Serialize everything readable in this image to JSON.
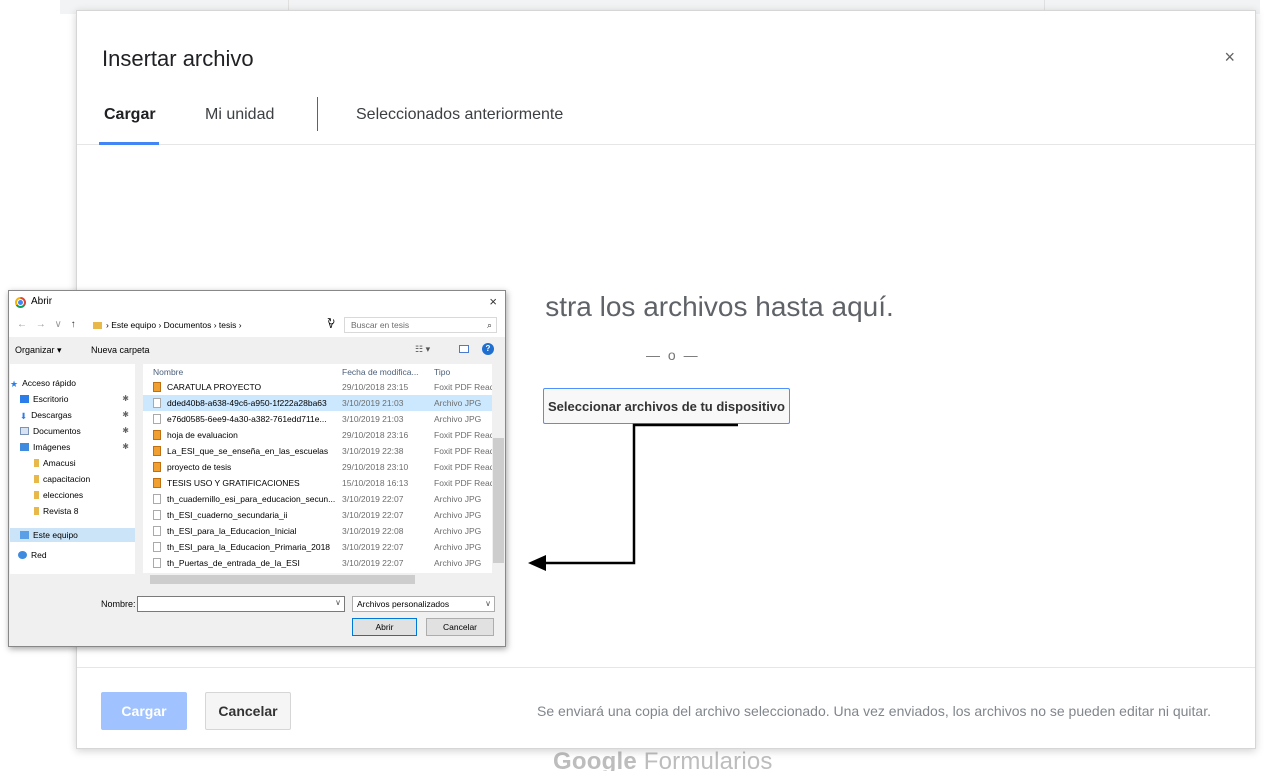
{
  "dialog": {
    "title": "Insertar archivo",
    "close_icon": "×",
    "tabs": [
      "Cargar",
      "Mi unidad",
      "Seleccionados anteriormente"
    ],
    "drop_text": "stra los archivos hasta aquí.",
    "or_text": "— o —",
    "select_button": "Seleccionar archivos de tu dispositivo",
    "upload_button": "Cargar",
    "cancel_button": "Cancelar",
    "footer_note": "Se enviará una copia del archivo seleccionado. Una vez enviados, los archivos no se pueden editar ni quitar."
  },
  "background": {
    "brand_google": "Google",
    "brand_product": " Formularios"
  },
  "open_dialog": {
    "title": "Abrir",
    "close": "×",
    "nav_arrows": "← → ∨",
    "nav_up": "↑",
    "address": "› Este equipo › Documentos › tesis ›",
    "address_dropdown": "∨",
    "refresh": "↻",
    "search_placeholder": "Buscar en tesis",
    "search_icon": "⌕",
    "organize": "Organizar ▾",
    "new_folder": "Nueva carpeta",
    "views_icon": "☷ ▾",
    "help_icon": "?",
    "columns": {
      "name": "Nombre",
      "date": "Fecha de modifica...",
      "type": "Tipo"
    },
    "nav_items": [
      {
        "label": "Acceso rápido",
        "pinned": false
      },
      {
        "label": "Escritorio",
        "pinned": true
      },
      {
        "label": "Descargas",
        "pinned": true
      },
      {
        "label": "Documentos",
        "pinned": true
      },
      {
        "label": "Imágenes",
        "pinned": true
      },
      {
        "label": "Amacusi",
        "pinned": false
      },
      {
        "label": "capacitacion",
        "pinned": false
      },
      {
        "label": "elecciones",
        "pinned": false
      },
      {
        "label": "Revista 8",
        "pinned": false
      },
      {
        "label": "Este equipo",
        "pinned": false
      },
      {
        "label": "Red",
        "pinned": false
      }
    ],
    "pin_icon": "✱",
    "files": [
      {
        "name": "CARATULA PROYECTO",
        "date": "29/10/2018 23:15",
        "type": "Foxit PDF Reader",
        "kind": "pdf"
      },
      {
        "name": "dded40b8-a638-49c6-a950-1f222a28ba63",
        "date": "3/10/2019 21:03",
        "type": "Archivo JPG",
        "kind": "jpg"
      },
      {
        "name": "e76d0585-6ee9-4a30-a382-761edd711e...",
        "date": "3/10/2019 21:03",
        "type": "Archivo JPG",
        "kind": "jpg"
      },
      {
        "name": "hoja de evaluacion",
        "date": "29/10/2018 23:16",
        "type": "Foxit PDF Reader",
        "kind": "pdf"
      },
      {
        "name": "La_ESI_que_se_enseña_en_las_escuelas",
        "date": "3/10/2019 22:38",
        "type": "Foxit PDF Reader",
        "kind": "pdf"
      },
      {
        "name": "proyecto de tesis",
        "date": "29/10/2018 23:10",
        "type": "Foxit PDF Reader",
        "kind": "pdf"
      },
      {
        "name": "TESIS USO Y GRATIFICACIONES",
        "date": "15/10/2018 16:13",
        "type": "Foxit PDF Reader",
        "kind": "pdf"
      },
      {
        "name": "th_cuadernillo_esi_para_educacion_secun...",
        "date": "3/10/2019 22:07",
        "type": "Archivo JPG",
        "kind": "jpg"
      },
      {
        "name": "th_ESI_cuaderno_secundaria_ii",
        "date": "3/10/2019 22:07",
        "type": "Archivo JPG",
        "kind": "jpg"
      },
      {
        "name": "th_ESI_para_la_Educacion_Inicial",
        "date": "3/10/2019 22:08",
        "type": "Archivo JPG",
        "kind": "jpg"
      },
      {
        "name": "th_ESI_para_la_Educacion_Primaria_2018",
        "date": "3/10/2019 22:07",
        "type": "Archivo JPG",
        "kind": "jpg"
      },
      {
        "name": "th_Puertas_de_entrada_de_la_ESI",
        "date": "3/10/2019 22:07",
        "type": "Archivo JPG",
        "kind": "jpg"
      }
    ],
    "name_label": "Nombre:",
    "name_value": "",
    "name_dropdown": "∨",
    "file_type": "Archivos personalizados",
    "file_type_dropdown": "∨",
    "open_button": "Abrir",
    "cancel_button": "Cancelar"
  }
}
